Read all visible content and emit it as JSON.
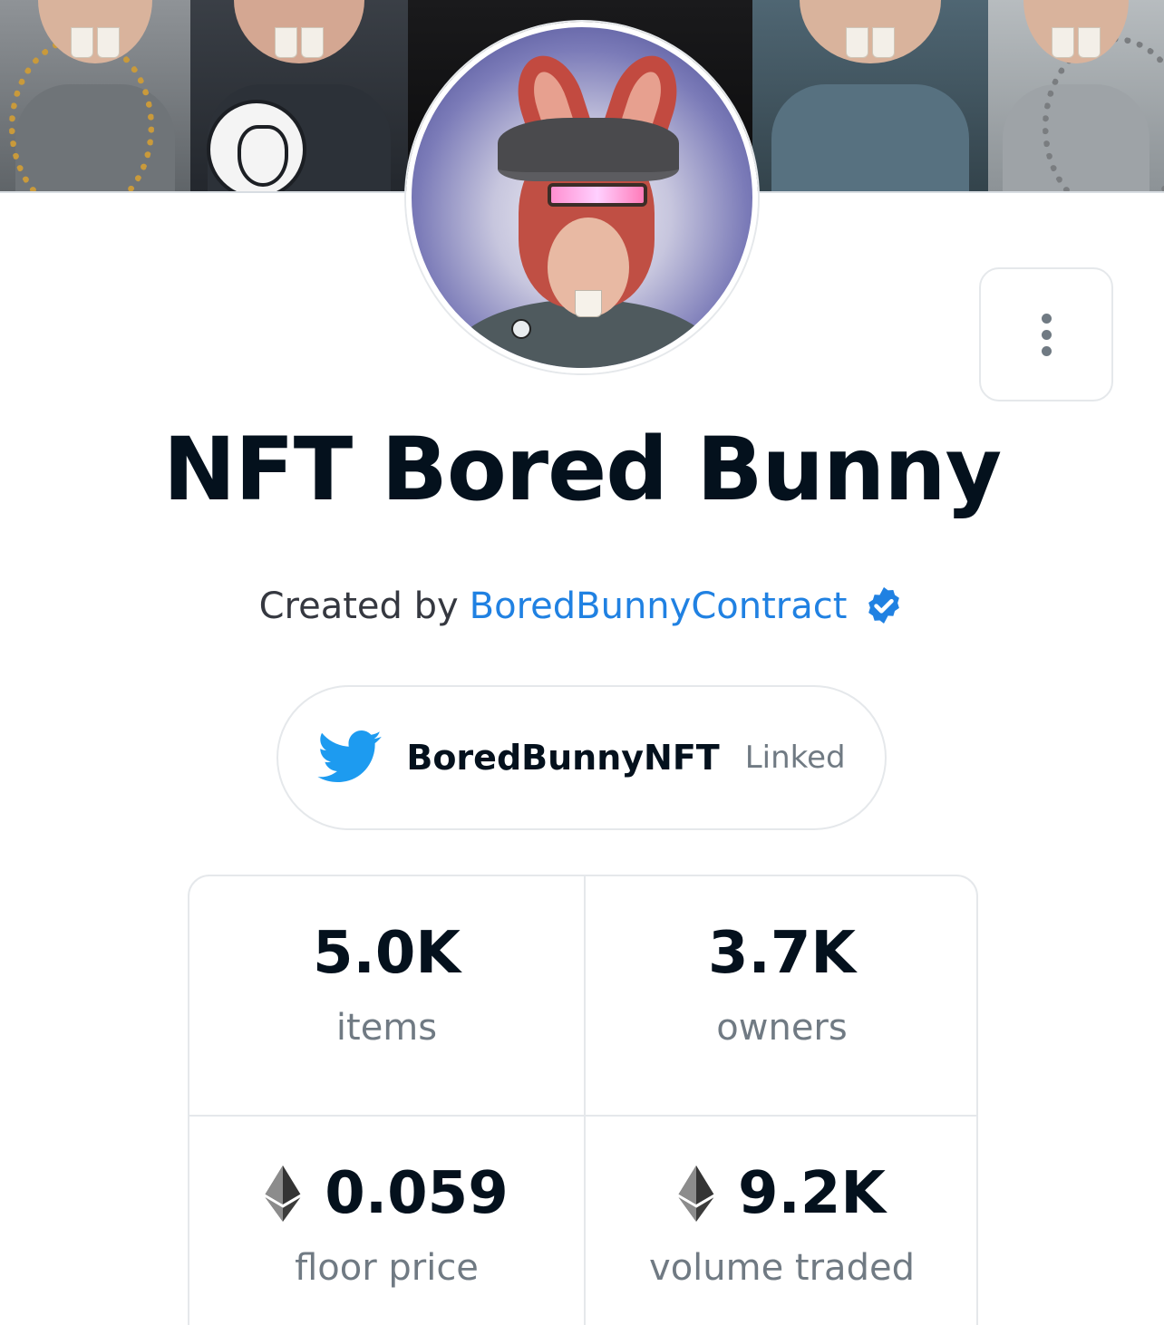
{
  "collection": {
    "name": "NFT Bored Bunny",
    "created_by_prefix": "Created by",
    "creator_name": "BoredBunnyContract"
  },
  "social": {
    "twitter_handle": "BoredBunnyNFT",
    "twitter_status": "Linked",
    "icon": "twitter-bird-icon"
  },
  "stats": [
    {
      "value": "5.0K",
      "label": "items",
      "eth": false
    },
    {
      "value": "3.7K",
      "label": "owners",
      "eth": false
    },
    {
      "value": "0.059",
      "label": "floor price",
      "eth": true
    },
    {
      "value": "9.2K",
      "label": "volume traded",
      "eth": true
    }
  ],
  "colors": {
    "link": "#2081e2",
    "title": "#04111d",
    "muted": "#707a83",
    "border": "#e5e8eb",
    "twitter": "#1d9bf0"
  },
  "icons": {
    "more": "vertical-ellipsis-icon",
    "verified": "verified-badge-icon",
    "currency": "ethereum-icon"
  }
}
